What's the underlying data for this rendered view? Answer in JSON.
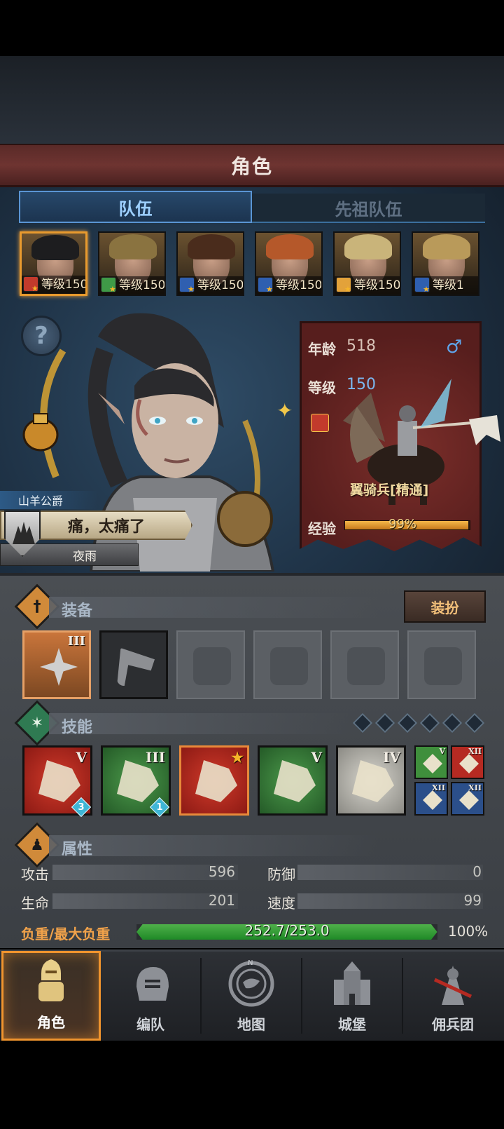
{
  "header": {
    "title": "角色"
  },
  "tabs": [
    {
      "label": "队伍",
      "active": true
    },
    {
      "label": "先祖队伍",
      "active": false
    }
  ],
  "party": [
    {
      "level_text": "等级150",
      "class_color": "#c23a2c",
      "hair": "#1d1d1f",
      "selected": true
    },
    {
      "level_text": "等级150",
      "class_color": "#3f9a47",
      "hair": "#8a7340",
      "selected": false
    },
    {
      "level_text": "等级150",
      "class_color": "#2f5fb0",
      "hair": "#4a2c1c",
      "selected": false
    },
    {
      "level_text": "等级150",
      "class_color": "#2f5fb0",
      "hair": "#b5582a",
      "selected": false
    },
    {
      "level_text": "等级150",
      "class_color": "#e3a23a",
      "hair": "#c9b47a",
      "selected": false
    },
    {
      "level_text": "等级1",
      "class_color": "#2f5fb0",
      "hair": "#b99a5a",
      "selected": false
    }
  ],
  "hero": {
    "title": "山羊公爵",
    "quote": "痛，太痛了",
    "name": "夜雨"
  },
  "info_card": {
    "age_label": "年龄",
    "age_value": "518",
    "gender_icon": "male-icon",
    "gender_symbol": "♂",
    "level_label": "等级",
    "level_value": "150",
    "unit_name": "翼骑兵[精通]",
    "exp_label": "经验",
    "exp_text": "99%",
    "exp_fraction": 0.99
  },
  "equipment": {
    "section_title": "装备",
    "dress_label": "装扮",
    "slots": [
      {
        "state": "filled",
        "roman": "III",
        "icon": "crossed-blades-icon"
      },
      {
        "state": "dark",
        "roman": "",
        "icon": "banner-icon"
      },
      {
        "state": "empty",
        "roman": "",
        "icon": "helmet-icon"
      },
      {
        "state": "empty",
        "roman": "",
        "icon": "armor-icon"
      },
      {
        "state": "empty",
        "roman": "",
        "icon": "boots-icon"
      },
      {
        "state": "empty",
        "roman": "",
        "icon": "ring-icon"
      }
    ]
  },
  "skills": {
    "section_title": "技能",
    "dot_count": 6,
    "main": [
      {
        "color": "red",
        "roman": "V",
        "badge": "3",
        "selected": false,
        "icon": "sword-strike-icon"
      },
      {
        "color": "green",
        "roman": "III",
        "badge": "1",
        "selected": false,
        "icon": "spear-thrust-icon"
      },
      {
        "color": "red",
        "roman": "★",
        "badge": "",
        "selected": true,
        "icon": "banner-charge-icon"
      },
      {
        "color": "green",
        "roman": "V",
        "badge": "",
        "selected": false,
        "icon": "burst-icon"
      },
      {
        "color": "gray",
        "roman": "IV",
        "badge": "",
        "selected": false,
        "icon": "shield-crystal-icon"
      }
    ],
    "mini": [
      {
        "color": "#3f8f3c",
        "roman": "V",
        "icon": "star-burst-icon"
      },
      {
        "color": "#b52a22",
        "roman": "XII",
        "icon": "sword-icon"
      },
      {
        "color": "#2b4f8a",
        "roman": "XII",
        "icon": "fist-icon"
      },
      {
        "color": "#2b4f8a",
        "roman": "XII",
        "icon": "wing-icon"
      }
    ]
  },
  "attributes": {
    "section_title": "属性",
    "rows": [
      {
        "label": "攻击",
        "value": "596"
      },
      {
        "label": "防御",
        "value": "0"
      },
      {
        "label": "生命",
        "value": "201"
      },
      {
        "label": "速度",
        "value": "99"
      }
    ],
    "load_label": "负重/最大负重",
    "load_text": "252.7/253.0",
    "load_pct": "100%",
    "load_fraction": 0.999
  },
  "nav": [
    {
      "label": "角色",
      "active": true,
      "icon": "knight-icon"
    },
    {
      "label": "编队",
      "active": false,
      "icon": "helmet-squad-icon"
    },
    {
      "label": "地图",
      "active": false,
      "icon": "compass-map-icon"
    },
    {
      "label": "城堡",
      "active": false,
      "icon": "castle-icon"
    },
    {
      "label": "佣兵团",
      "active": false,
      "icon": "mercenary-icon"
    }
  ],
  "colors": {
    "accent_orange": "#f0942e",
    "tab_blue": "#5a95d4",
    "banner_red": "#6e3431",
    "load_green": "#2f9a34"
  }
}
